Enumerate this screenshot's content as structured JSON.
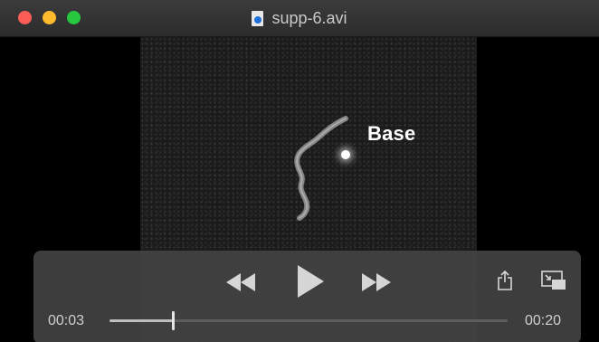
{
  "window": {
    "title": "supp-6.avi",
    "file_icon": "video-file-icon"
  },
  "video": {
    "overlay_label": "Base"
  },
  "controls": {
    "current_time": "00:03",
    "total_time": "00:20",
    "progress": 0.16,
    "icons": {
      "rewind": "rewind-icon",
      "play": "play-icon",
      "forward": "fast-forward-icon",
      "share": "share-icon",
      "pip": "picture-in-picture-icon"
    }
  },
  "colors": {
    "close": "#fc5e57",
    "minimize": "#febb2e",
    "maximize": "#27c840",
    "controls_bg": "#424242"
  }
}
